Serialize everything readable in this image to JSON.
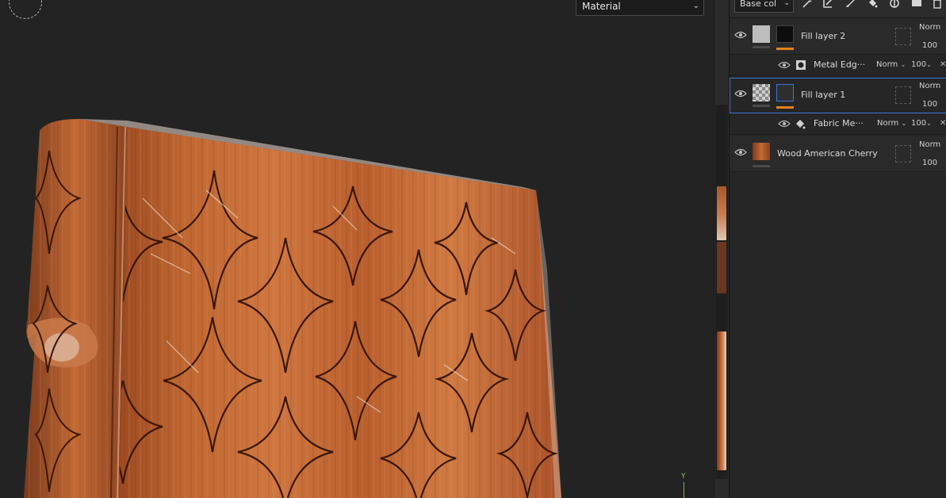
{
  "viewport": {
    "mode_select": {
      "value": "Material"
    },
    "axis_label": "Y"
  },
  "panel": {
    "channel_select": {
      "value": "Base col"
    },
    "toolbar_icons": [
      "magic-wand-icon",
      "paint-bucket-icon",
      "brush-icon",
      "fill-icon",
      "mask-icon",
      "folder-icon",
      "trash-icon"
    ],
    "layers": [
      {
        "name": "Fill layer 2",
        "blend": "Norm",
        "opacity": "100",
        "effect": {
          "name": "Metal Edg···",
          "blend": "Norm",
          "opacity": "100"
        }
      },
      {
        "name": "Fill layer 1",
        "blend": "Norm",
        "opacity": "100",
        "selected": true,
        "effect": {
          "name": "Fabric Me···",
          "blend": "Norm",
          "opacity": "100"
        }
      },
      {
        "name": "Wood American Cherry",
        "blend": "Norm",
        "opacity": "100"
      }
    ]
  },
  "colors": {
    "accent_orange": "#e8821a",
    "selection_blue": "#3a78d6",
    "wood": "#b85c2b"
  }
}
